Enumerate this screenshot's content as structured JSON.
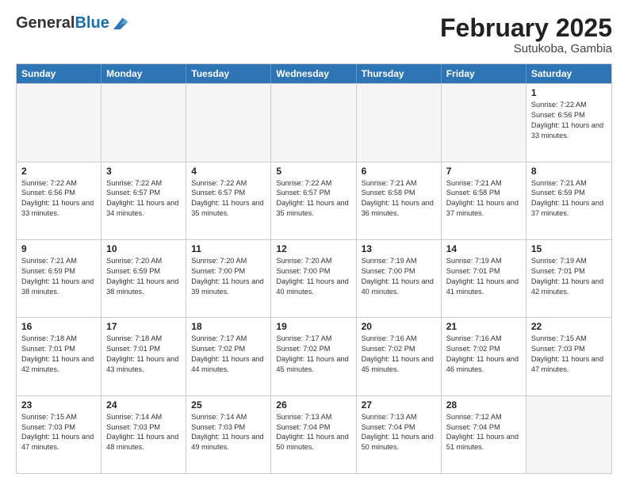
{
  "logo": {
    "general": "General",
    "blue": "Blue"
  },
  "header": {
    "month": "February 2025",
    "location": "Sutukoba, Gambia"
  },
  "weekdays": [
    "Sunday",
    "Monday",
    "Tuesday",
    "Wednesday",
    "Thursday",
    "Friday",
    "Saturday"
  ],
  "weeks": [
    [
      {
        "day": "",
        "info": ""
      },
      {
        "day": "",
        "info": ""
      },
      {
        "day": "",
        "info": ""
      },
      {
        "day": "",
        "info": ""
      },
      {
        "day": "",
        "info": ""
      },
      {
        "day": "",
        "info": ""
      },
      {
        "day": "1",
        "info": "Sunrise: 7:22 AM\nSunset: 6:56 PM\nDaylight: 11 hours and 33 minutes."
      }
    ],
    [
      {
        "day": "2",
        "info": "Sunrise: 7:22 AM\nSunset: 6:56 PM\nDaylight: 11 hours and 33 minutes."
      },
      {
        "day": "3",
        "info": "Sunrise: 7:22 AM\nSunset: 6:57 PM\nDaylight: 11 hours and 34 minutes."
      },
      {
        "day": "4",
        "info": "Sunrise: 7:22 AM\nSunset: 6:57 PM\nDaylight: 11 hours and 35 minutes."
      },
      {
        "day": "5",
        "info": "Sunrise: 7:22 AM\nSunset: 6:57 PM\nDaylight: 11 hours and 35 minutes."
      },
      {
        "day": "6",
        "info": "Sunrise: 7:21 AM\nSunset: 6:58 PM\nDaylight: 11 hours and 36 minutes."
      },
      {
        "day": "7",
        "info": "Sunrise: 7:21 AM\nSunset: 6:58 PM\nDaylight: 11 hours and 37 minutes."
      },
      {
        "day": "8",
        "info": "Sunrise: 7:21 AM\nSunset: 6:59 PM\nDaylight: 11 hours and 37 minutes."
      }
    ],
    [
      {
        "day": "9",
        "info": "Sunrise: 7:21 AM\nSunset: 6:59 PM\nDaylight: 11 hours and 38 minutes."
      },
      {
        "day": "10",
        "info": "Sunrise: 7:20 AM\nSunset: 6:59 PM\nDaylight: 11 hours and 38 minutes."
      },
      {
        "day": "11",
        "info": "Sunrise: 7:20 AM\nSunset: 7:00 PM\nDaylight: 11 hours and 39 minutes."
      },
      {
        "day": "12",
        "info": "Sunrise: 7:20 AM\nSunset: 7:00 PM\nDaylight: 11 hours and 40 minutes."
      },
      {
        "day": "13",
        "info": "Sunrise: 7:19 AM\nSunset: 7:00 PM\nDaylight: 11 hours and 40 minutes."
      },
      {
        "day": "14",
        "info": "Sunrise: 7:19 AM\nSunset: 7:01 PM\nDaylight: 11 hours and 41 minutes."
      },
      {
        "day": "15",
        "info": "Sunrise: 7:19 AM\nSunset: 7:01 PM\nDaylight: 11 hours and 42 minutes."
      }
    ],
    [
      {
        "day": "16",
        "info": "Sunrise: 7:18 AM\nSunset: 7:01 PM\nDaylight: 11 hours and 42 minutes."
      },
      {
        "day": "17",
        "info": "Sunrise: 7:18 AM\nSunset: 7:01 PM\nDaylight: 11 hours and 43 minutes."
      },
      {
        "day": "18",
        "info": "Sunrise: 7:17 AM\nSunset: 7:02 PM\nDaylight: 11 hours and 44 minutes."
      },
      {
        "day": "19",
        "info": "Sunrise: 7:17 AM\nSunset: 7:02 PM\nDaylight: 11 hours and 45 minutes."
      },
      {
        "day": "20",
        "info": "Sunrise: 7:16 AM\nSunset: 7:02 PM\nDaylight: 11 hours and 45 minutes."
      },
      {
        "day": "21",
        "info": "Sunrise: 7:16 AM\nSunset: 7:02 PM\nDaylight: 11 hours and 46 minutes."
      },
      {
        "day": "22",
        "info": "Sunrise: 7:15 AM\nSunset: 7:03 PM\nDaylight: 11 hours and 47 minutes."
      }
    ],
    [
      {
        "day": "23",
        "info": "Sunrise: 7:15 AM\nSunset: 7:03 PM\nDaylight: 11 hours and 47 minutes."
      },
      {
        "day": "24",
        "info": "Sunrise: 7:14 AM\nSunset: 7:03 PM\nDaylight: 11 hours and 48 minutes."
      },
      {
        "day": "25",
        "info": "Sunrise: 7:14 AM\nSunset: 7:03 PM\nDaylight: 11 hours and 49 minutes."
      },
      {
        "day": "26",
        "info": "Sunrise: 7:13 AM\nSunset: 7:04 PM\nDaylight: 11 hours and 50 minutes."
      },
      {
        "day": "27",
        "info": "Sunrise: 7:13 AM\nSunset: 7:04 PM\nDaylight: 11 hours and 50 minutes."
      },
      {
        "day": "28",
        "info": "Sunrise: 7:12 AM\nSunset: 7:04 PM\nDaylight: 11 hours and 51 minutes."
      },
      {
        "day": "",
        "info": ""
      }
    ]
  ]
}
